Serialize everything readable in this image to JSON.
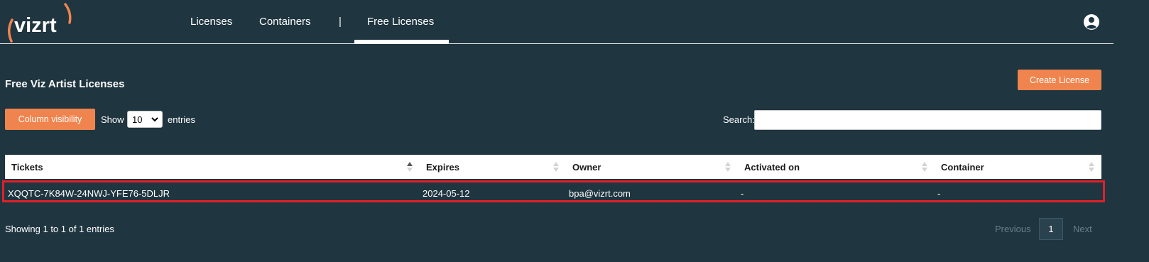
{
  "brand": {
    "logo_text": "vizrt",
    "accent_color": "#f0844e"
  },
  "nav": {
    "links": [
      "Licenses",
      "Containers",
      "Free Licenses"
    ],
    "separator": "|",
    "active": "Free Licenses",
    "user_icon": "user-circle-icon"
  },
  "page": {
    "title": "Free Viz Artist Licenses",
    "create_button": "Create License",
    "column_visibility_button": "Column visibility",
    "show_label": "Show",
    "entries_value": "10",
    "entries_label": "entries",
    "search_label": "Search:",
    "search_value": ""
  },
  "table": {
    "columns": [
      "Tickets",
      "Expires",
      "Owner",
      "Activated on",
      "Container"
    ],
    "sorted_column": "Tickets",
    "rows": [
      [
        "XQQTC-7K84W-24NWJ-YFE76-5DLJR",
        "2024-05-12",
        "bpa@vizrt.com",
        "-",
        "-"
      ]
    ],
    "highlight_color": "#e0202a"
  },
  "footer": {
    "info": "Showing 1 to 1 of 1 entries",
    "previous": "Previous",
    "current_page": "1",
    "next": "Next"
  }
}
